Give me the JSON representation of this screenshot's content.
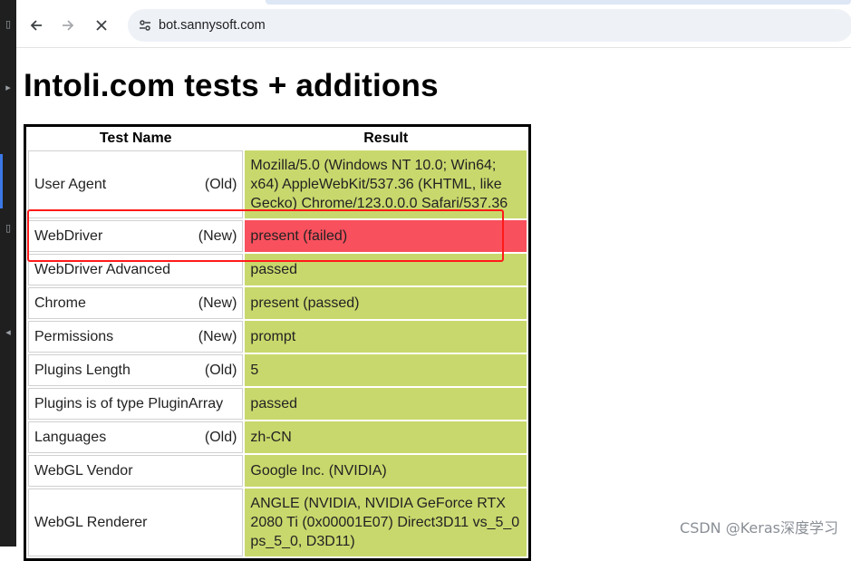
{
  "browser": {
    "url": "bot.sannysoft.com"
  },
  "page": {
    "title": "Intoli.com tests + additions",
    "table": {
      "headers": [
        "Test Name",
        "Result"
      ],
      "rows": [
        {
          "name": "User Agent",
          "tag": "(Old)",
          "result": "Mozilla/5.0 (Windows NT 10.0; Win64; x64) AppleWebKit/537.36 (KHTML, like Gecko) Chrome/123.0.0.0 Safari/537.36",
          "status": "passed"
        },
        {
          "name": "WebDriver",
          "tag": "(New)",
          "result": "present (failed)",
          "status": "failed"
        },
        {
          "name": "WebDriver Advanced",
          "tag": "",
          "result": "passed",
          "status": "passed"
        },
        {
          "name": "Chrome",
          "tag": "(New)",
          "result": "present (passed)",
          "status": "passed"
        },
        {
          "name": "Permissions",
          "tag": "(New)",
          "result": "prompt",
          "status": "passed"
        },
        {
          "name": "Plugins Length",
          "tag": "(Old)",
          "result": "5",
          "status": "passed"
        },
        {
          "name": "Plugins is of type PluginArray",
          "tag": "",
          "result": "passed",
          "status": "passed"
        },
        {
          "name": "Languages",
          "tag": "(Old)",
          "result": "zh-CN",
          "status": "passed"
        },
        {
          "name": "WebGL Vendor",
          "tag": "",
          "result": "Google Inc. (NVIDIA)",
          "status": "passed"
        },
        {
          "name": "WebGL Renderer",
          "tag": "",
          "result": "ANGLE (NVIDIA, NVIDIA GeForce RTX 2080 Ti (0x00001E07) Direct3D11 vs_5_0 ps_5_0, D3D11)",
          "status": "passed"
        }
      ]
    }
  },
  "watermark": "CSDN @Keras深度学习",
  "colors": {
    "passed": "#c9d86c",
    "failed": "#f9505d",
    "annotation": "#ff1a1a"
  },
  "icons": {
    "back": "arrow-left-icon",
    "forward": "arrow-right-icon",
    "stop": "close-icon",
    "site_info": "tune-icon"
  }
}
